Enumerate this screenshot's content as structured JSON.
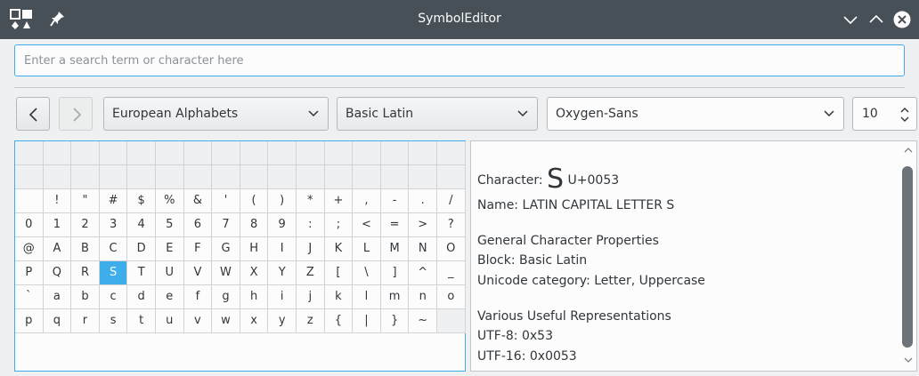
{
  "window": {
    "title": "SymbolEditor",
    "app_icon": "symbol-editor-app-icon",
    "pin_icon": "pin-icon",
    "controls": [
      "minimize-chevron-icon",
      "maximize-chevron-icon",
      "close-icon"
    ]
  },
  "search": {
    "placeholder": "Enter a search term or character here",
    "value": ""
  },
  "toolbar": {
    "back_icon": "chevron-left-icon",
    "forward_icon": "chevron-right-icon",
    "section": "European Alphabets",
    "block": "Basic Latin",
    "font": "Oxygen-Sans",
    "font_size": "10"
  },
  "grid": {
    "rows": [
      [
        "",
        "",
        "",
        "",
        "",
        "",
        "",
        "",
        "",
        "",
        "",
        "",
        "",
        "",
        "",
        ""
      ],
      [
        "",
        "",
        "",
        "",
        "",
        "",
        "",
        "",
        "",
        "",
        "",
        "",
        "",
        "",
        "",
        ""
      ],
      [
        " ",
        "!",
        "\"",
        "#",
        "$",
        "%",
        "&",
        "'",
        "(",
        ")",
        "*",
        "+",
        ",",
        "-",
        ".",
        "/"
      ],
      [
        "0",
        "1",
        "2",
        "3",
        "4",
        "5",
        "6",
        "7",
        "8",
        "9",
        ":",
        ";",
        "<",
        "=",
        ">",
        "?"
      ],
      [
        "@",
        "A",
        "B",
        "C",
        "D",
        "E",
        "F",
        "G",
        "H",
        "I",
        "J",
        "K",
        "L",
        "M",
        "N",
        "O"
      ],
      [
        "P",
        "Q",
        "R",
        "S",
        "T",
        "U",
        "V",
        "W",
        "X",
        "Y",
        "Z",
        "[",
        "\\",
        "]",
        "^",
        "_"
      ],
      [
        "`",
        "a",
        "b",
        "c",
        "d",
        "e",
        "f",
        "g",
        "h",
        "i",
        "j",
        "k",
        "l",
        "m",
        "n",
        "o"
      ],
      [
        "p",
        "q",
        "r",
        "s",
        "t",
        "u",
        "v",
        "w",
        "x",
        "y",
        "z",
        "{",
        "|",
        "}",
        "~",
        ""
      ]
    ],
    "selected": "S"
  },
  "info": {
    "character_label": "Character:",
    "character": "S",
    "codepoint": "U+0053",
    "name": "Name: LATIN CAPITAL LETTER S",
    "general_heading": "General Character Properties",
    "block": "Block: Basic Latin",
    "category": "Unicode category: Letter, Uppercase",
    "repr_heading": "Various Useful Representations",
    "utf8": "UTF-8: 0x53",
    "utf16": "UTF-16: 0x0053"
  },
  "colors": {
    "titlebar": "#475057",
    "accent": "#3daee9",
    "window_bg": "#eff0f1",
    "close_button": "#fcfcfc"
  }
}
